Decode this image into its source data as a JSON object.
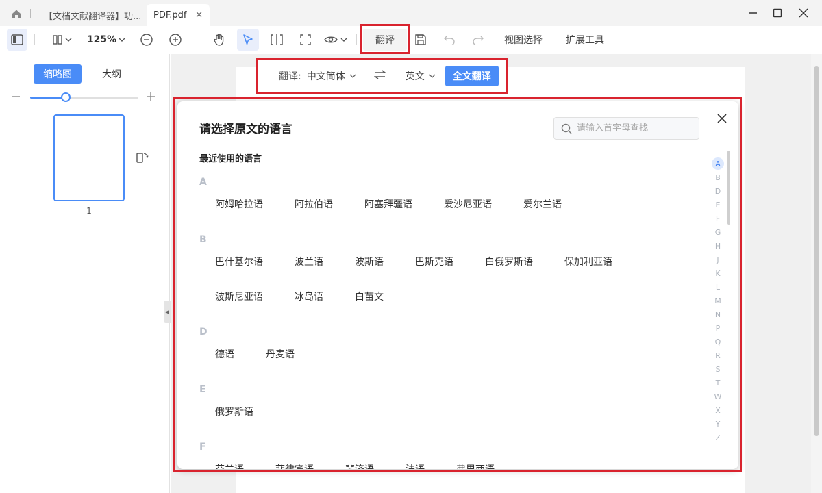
{
  "tabs": [
    {
      "label": "【文档文献翻译器】功..."
    },
    {
      "label": "PDF.pdf"
    }
  ],
  "toolbar": {
    "zoom": "125%",
    "translate_label": "翻译",
    "view_select_label": "视图选择",
    "extend_tools_label": "扩展工具"
  },
  "leftpanel": {
    "tab_thumbnail": "缩略图",
    "tab_outline": "大纲",
    "page_number": "1",
    "slider_value": 0.33
  },
  "transbar": {
    "label": "翻译:",
    "source_lang": "中文简体",
    "target_lang": "英文",
    "full_translate": "全文翻译"
  },
  "dialog": {
    "title": "请选择原文的语言",
    "search_placeholder": "请输入首字母查找",
    "recent_title": "最近使用的语言",
    "groups": [
      {
        "letter": "A",
        "items": [
          "阿姆哈拉语",
          "阿拉伯语",
          "阿塞拜疆语",
          "爱沙尼亚语",
          "爱尔兰语"
        ]
      },
      {
        "letter": "B",
        "items": [
          "巴什基尔语",
          "波兰语",
          "波斯语",
          "巴斯克语",
          "白俄罗斯语",
          "保加利亚语",
          "波斯尼亚语",
          "冰岛语",
          "白苗文"
        ]
      },
      {
        "letter": "D",
        "items": [
          "德语",
          "丹麦语"
        ]
      },
      {
        "letter": "E",
        "items": [
          "俄罗斯语"
        ]
      },
      {
        "letter": "F",
        "items": [
          "芬兰语",
          "菲律宾语",
          "斐济语",
          "法语",
          "弗里西语"
        ]
      }
    ],
    "alphabet": [
      "A",
      "B",
      "D",
      "E",
      "F",
      "G",
      "H",
      "J",
      "K",
      "L",
      "M",
      "N",
      "P",
      "Q",
      "R",
      "S",
      "T",
      "W",
      "X",
      "Y",
      "Z"
    ],
    "active_letter": "A"
  },
  "colors": {
    "accent": "#4a8cf7",
    "highlight": "#d9232e"
  }
}
